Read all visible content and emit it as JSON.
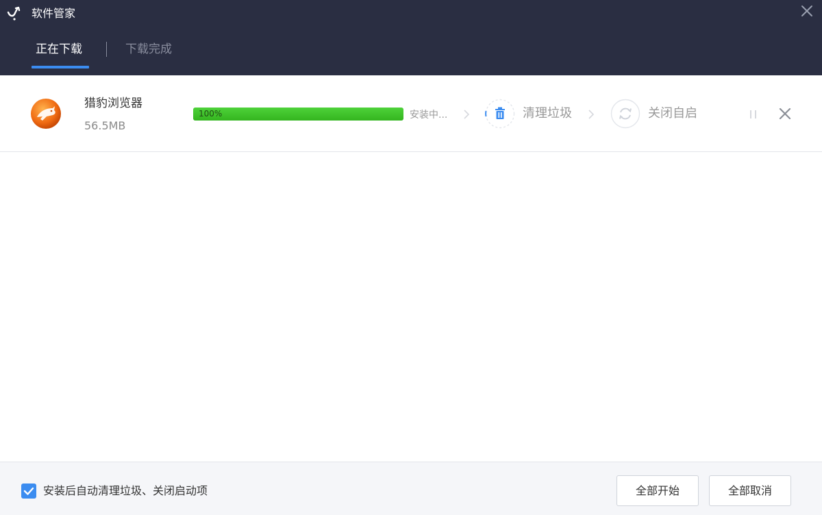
{
  "window": {
    "title": "软件管家",
    "logo_icon": "tick-logo-icon",
    "close_icon": "close-icon"
  },
  "tabs": [
    {
      "label": "正在下载",
      "active": true
    },
    {
      "label": "下载完成",
      "active": false
    }
  ],
  "download_item": {
    "name": "猎豹浏览器",
    "size": "56.5MB",
    "icon": "cheetah-browser-icon",
    "progress_percent": 100,
    "progress_label": "100%",
    "status": "安装中...",
    "steps": [
      {
        "label": "清理垃圾",
        "icon": "trash-icon"
      },
      {
        "label": "关闭自启",
        "icon": "refresh-icon"
      }
    ],
    "pause_icon": "pause-icon",
    "remove_icon": "close-icon"
  },
  "footer": {
    "checkbox_checked": true,
    "checkbox_label": "安装后自动清理垃圾、关闭启动项",
    "start_all_label": "全部开始",
    "cancel_all_label": "全部取消"
  },
  "colors": {
    "header_bg": "#2a2e42",
    "accent": "#3b8cf0",
    "progress": "#3fc22a",
    "footer_bg": "#f5f6f9"
  }
}
